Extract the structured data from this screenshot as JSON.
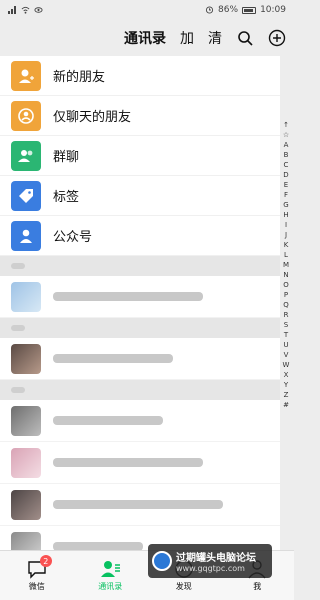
{
  "status": {
    "battery": "86%",
    "time": "10:09"
  },
  "header": {
    "title": "通讯录",
    "add_label": "加",
    "clear_label": "清"
  },
  "entries": [
    {
      "label": "新的朋友",
      "color": "#f0a43a",
      "icon": "add-friend-icon"
    },
    {
      "label": "仅聊天的朋友",
      "color": "#f0a43a",
      "icon": "chat-only-friend-icon"
    },
    {
      "label": "群聊",
      "color": "#2bb673",
      "icon": "group-chat-icon"
    },
    {
      "label": "标签",
      "color": "#3a7de0",
      "icon": "tag-icon"
    },
    {
      "label": "公众号",
      "color": "#3a7de0",
      "icon": "official-account-icon"
    }
  ],
  "alpha_index": [
    "↑",
    "☆",
    "A",
    "B",
    "C",
    "D",
    "E",
    "F",
    "G",
    "H",
    "I",
    "J",
    "K",
    "L",
    "M",
    "N",
    "O",
    "P",
    "Q",
    "R",
    "S",
    "T",
    "U",
    "V",
    "W",
    "X",
    "Y",
    "Z",
    "#"
  ],
  "tabs": [
    {
      "label": "微信",
      "badge": "2",
      "icon": "chat-bubble-icon",
      "active": false
    },
    {
      "label": "通讯录",
      "icon": "contacts-icon",
      "active": true
    },
    {
      "label": "发现",
      "icon": "compass-icon",
      "active": false
    },
    {
      "label": "我",
      "icon": "person-icon",
      "active": false
    }
  ],
  "watermark": {
    "title": "过期罐头电脑论坛",
    "url": "www.gqgtpc.com"
  }
}
